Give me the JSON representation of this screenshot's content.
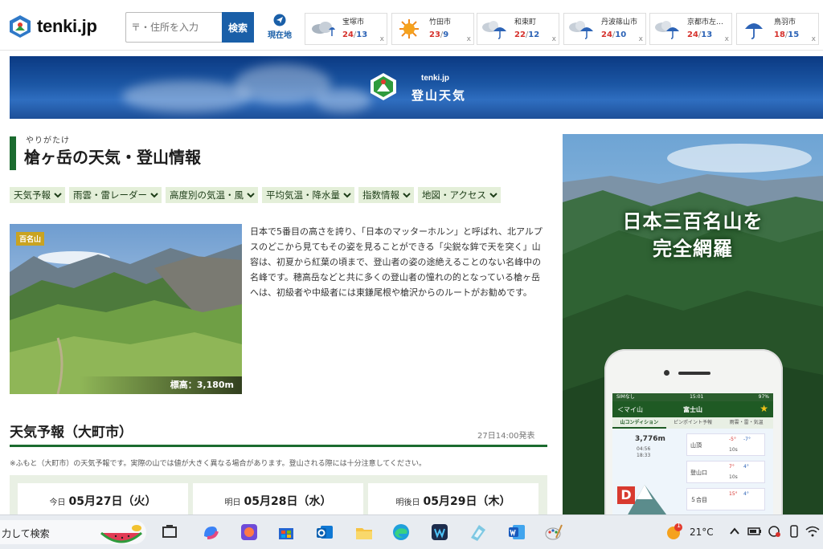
{
  "header": {
    "logo_text": "tenki.jp",
    "search_placeholder": "〒・住所を入力",
    "search_button": "検索",
    "location_button": "現在地",
    "close_mark": "x",
    "cities": [
      {
        "name": "宝塚市",
        "high": "24",
        "low": "13",
        "icon": "cloud-rain-icon"
      },
      {
        "name": "竹田市",
        "high": "23",
        "low": "9",
        "icon": "sun-icon"
      },
      {
        "name": "和束町",
        "high": "22",
        "low": "12",
        "icon": "cloud-umbrella-icon"
      },
      {
        "name": "丹波篠山市",
        "high": "24",
        "low": "10",
        "icon": "cloud-umbrella-icon"
      },
      {
        "name": "京都市左…",
        "high": "24",
        "low": "13",
        "icon": "cloud-umbrella-icon"
      },
      {
        "name": "鳥羽市",
        "high": "18",
        "low": "15",
        "icon": "umbrella-icon"
      }
    ]
  },
  "banner": {
    "brand": "tenki.jp",
    "title": "登山天気"
  },
  "page": {
    "ruby": "やりがたけ",
    "title": "槍ヶ岳の天気・登山情報"
  },
  "nav": [
    "天気予報",
    "雨雲・雷レーダー",
    "高度別の気温・風",
    "平均気温・降水量",
    "指数情報",
    "地図・アクセス"
  ],
  "mountain": {
    "badge": "百名山",
    "elevation": "標高：3,180m",
    "description": "日本で5番目の高さを誇り、「日本のマッターホルン」と呼ばれ、北アルプスのどこから見てもその姿を見ることができる「尖鋭な鉾で天を突く」山容は、初夏から紅葉の頃まで、登山者の姿の途絶えることのない名峰中の名峰です。穂高岳などと共に多くの登山者の憧れの的となっている槍ヶ岳へは、初級者や中級者には東鎌尾根や槍沢からのルートがお勧めです。"
  },
  "forecast": {
    "title": "天気予報（大町市）",
    "issued": "27日14:00発表",
    "note": "※ふもと（大町市）の天気予報です。実際の山では値が大きく異なる場合があります。登山される際には十分注意してください。",
    "days": [
      {
        "prefix": "今日",
        "date": "05月27日（火）"
      },
      {
        "prefix": "明日",
        "date": "05月28日（水）"
      },
      {
        "prefix": "明後日",
        "date": "05月29日（木）"
      }
    ]
  },
  "ad": {
    "line1": "日本三百名山を",
    "line2": "完全網羅",
    "app": {
      "status_left": "SIMなし",
      "status_time": "15:01",
      "status_right": "97%",
      "back": "＜マイ山",
      "mountain": "富士山",
      "tabs": [
        "山コンディション",
        "ピンポイント予報",
        "雨雲・雷・気温"
      ],
      "altitude": "3,776m",
      "time1": "04:56",
      "time2": "18:33",
      "rows": [
        {
          "name": "山頂",
          "hi": "-5°",
          "lo": "-7°",
          "wind": "10s"
        },
        {
          "name": "登山口",
          "hi": "7°",
          "lo": "4°",
          "wind": "10s"
        },
        {
          "name": "５合目",
          "hi": "15°",
          "lo": "4°",
          "wind": ""
        }
      ]
    }
  },
  "taskbar": {
    "search_label": "力して検索",
    "temperature": "21°C",
    "weather_badge": "1"
  }
}
